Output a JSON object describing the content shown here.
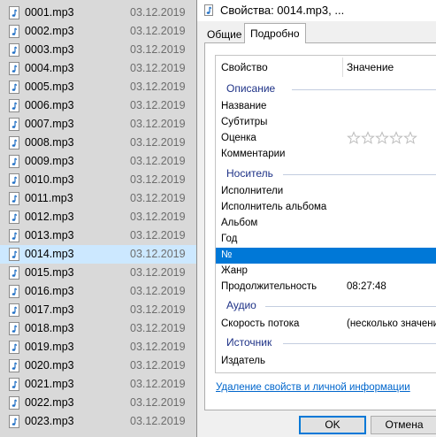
{
  "explorer": {
    "files": [
      {
        "name": "0001.mp3",
        "date": "03.12.2019"
      },
      {
        "name": "0002.mp3",
        "date": "03.12.2019"
      },
      {
        "name": "0003.mp3",
        "date": "03.12.2019"
      },
      {
        "name": "0004.mp3",
        "date": "03.12.2019"
      },
      {
        "name": "0005.mp3",
        "date": "03.12.2019"
      },
      {
        "name": "0006.mp3",
        "date": "03.12.2019"
      },
      {
        "name": "0007.mp3",
        "date": "03.12.2019"
      },
      {
        "name": "0008.mp3",
        "date": "03.12.2019"
      },
      {
        "name": "0009.mp3",
        "date": "03.12.2019"
      },
      {
        "name": "0010.mp3",
        "date": "03.12.2019"
      },
      {
        "name": "0011.mp3",
        "date": "03.12.2019"
      },
      {
        "name": "0012.mp3",
        "date": "03.12.2019"
      },
      {
        "name": "0013.mp3",
        "date": "03.12.2019"
      },
      {
        "name": "0014.mp3",
        "date": "03.12.2019"
      },
      {
        "name": "0015.mp3",
        "date": "03.12.2019"
      },
      {
        "name": "0016.mp3",
        "date": "03.12.2019"
      },
      {
        "name": "0017.mp3",
        "date": "03.12.2019"
      },
      {
        "name": "0018.mp3",
        "date": "03.12.2019"
      },
      {
        "name": "0019.mp3",
        "date": "03.12.2019"
      },
      {
        "name": "0020.mp3",
        "date": "03.12.2019"
      },
      {
        "name": "0021.mp3",
        "date": "03.12.2019"
      },
      {
        "name": "0022.mp3",
        "date": "03.12.2019"
      },
      {
        "name": "0023.mp3",
        "date": "03.12.2019"
      }
    ],
    "file_icon": "audio-file-icon",
    "selected_file": "0014.mp3"
  },
  "dialog": {
    "title": "Свойства: 0014.mp3, ...",
    "title_icon": "audio-file-icon",
    "tabs": {
      "general": "Общие",
      "details": "Подробно"
    },
    "active_tab": "Подробно",
    "columns": {
      "property": "Свойство",
      "value": "Значение"
    },
    "groups": {
      "description": "Описание",
      "media": "Носитель",
      "audio": "Аудио",
      "source": "Источник"
    },
    "props": {
      "title": {
        "name": "Название",
        "value": ""
      },
      "subtitle": {
        "name": "Субтитры",
        "value": ""
      },
      "rating": {
        "name": "Оценка",
        "stars": 0,
        "max_stars": 5
      },
      "comments": {
        "name": "Комментарии",
        "value": ""
      },
      "artists": {
        "name": "Исполнители",
        "value": ""
      },
      "album_artist": {
        "name": "Исполнитель альбома",
        "value": ""
      },
      "album": {
        "name": "Альбом",
        "value": ""
      },
      "year": {
        "name": "Год",
        "value": ""
      },
      "track": {
        "name": "№",
        "value": ""
      },
      "genre": {
        "name": "Жанр",
        "value": ""
      },
      "duration": {
        "name": "Продолжительность",
        "value": "08:27:48"
      },
      "bitrate": {
        "name": "Скорость потока",
        "value": "(несколько значени"
      },
      "publisher": {
        "name": "Издатель",
        "value": ""
      }
    },
    "selected_prop": "№",
    "remove_link": "Удаление свойств и личной информации",
    "buttons": {
      "ok": "OK",
      "cancel": "Отмена"
    },
    "colors": {
      "accent": "#0078d7",
      "group_text": "#1e3287",
      "link": "#0066cc"
    }
  }
}
